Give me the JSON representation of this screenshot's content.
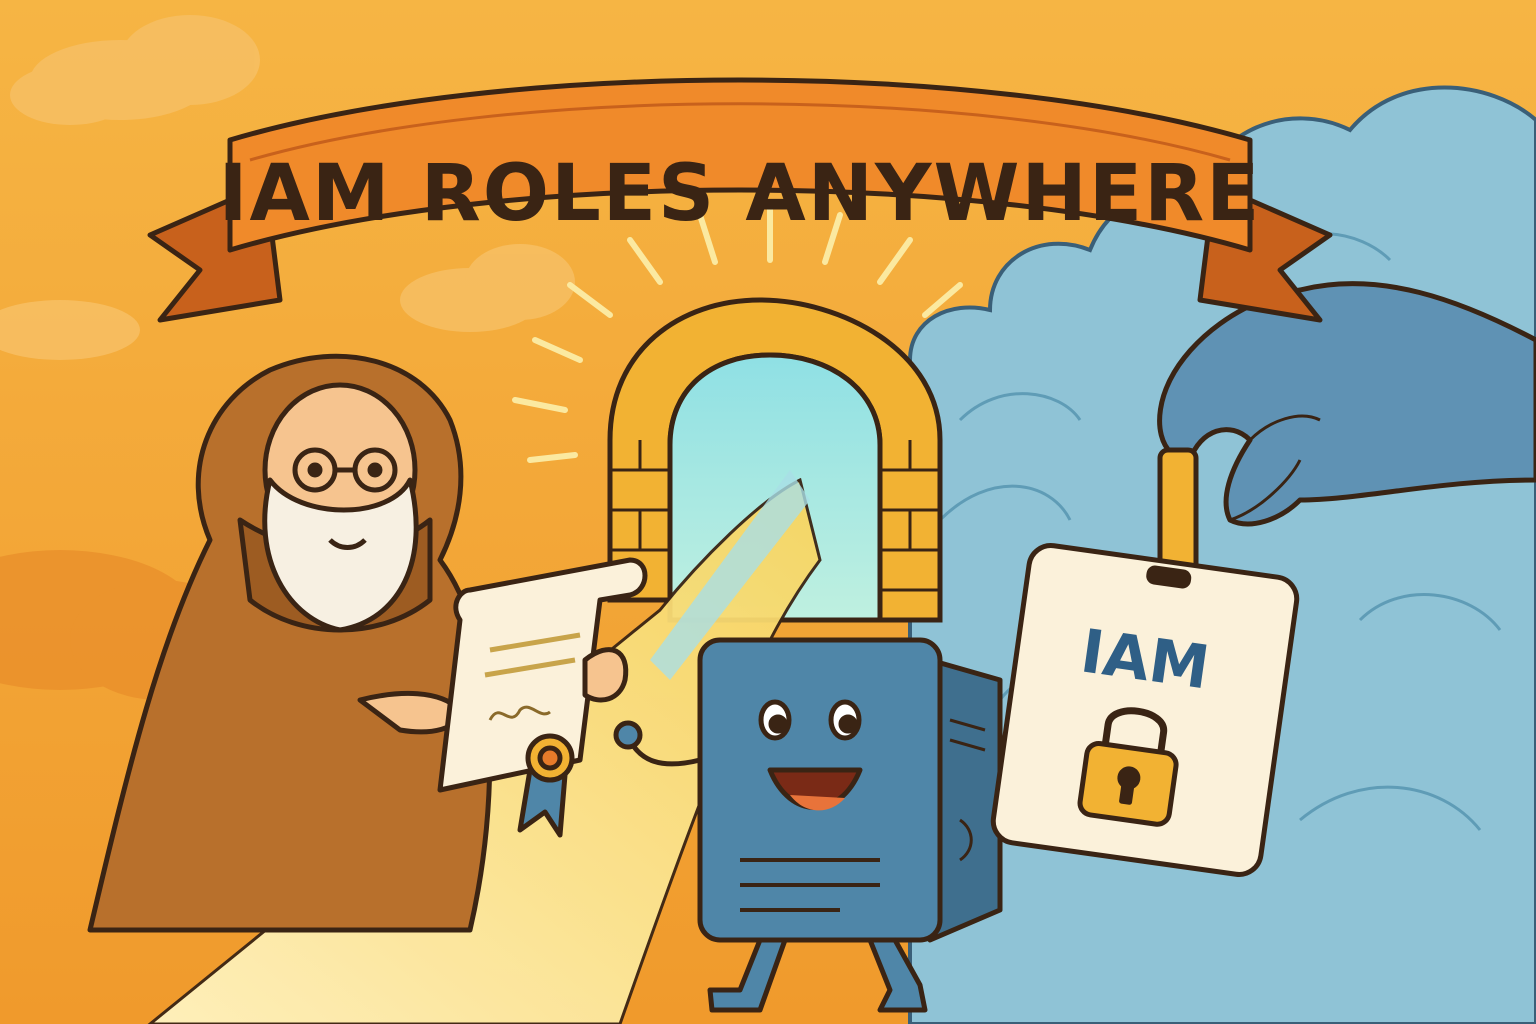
{
  "banner": {
    "title": "IAM ROLES ANYWHERE"
  },
  "badge": {
    "label": "IAM",
    "icon": "padlock-icon"
  },
  "colors": {
    "sky": "#f3a93a",
    "ribbon": "#f08a2a",
    "ribbon_dark": "#c8611c",
    "outline": "#3a2414",
    "cloud": "#8fc3d6",
    "cloud_dark": "#5f9cb6",
    "server": "#4f86a8",
    "robe": "#b8702c",
    "light_beam": "#fbe89a",
    "badge_card": "#fbf1da",
    "badge_text": "#2f5f86",
    "lock": "#f2b233"
  }
}
